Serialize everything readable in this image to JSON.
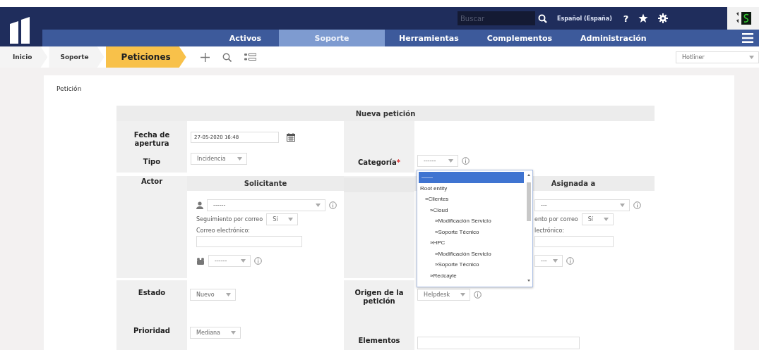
{
  "header": {
    "search": {
      "placeholder": "Buscar"
    },
    "language": "Español (España)",
    "help": "?"
  },
  "nav": [
    {
      "label": "Activos",
      "selected": false
    },
    {
      "label": "Soporte",
      "selected": true
    },
    {
      "label": "Herramientas",
      "selected": false
    },
    {
      "label": "Complementos",
      "selected": false
    },
    {
      "label": "Administración",
      "selected": false
    }
  ],
  "breadcrumb": [
    {
      "label": "Inicio",
      "selected": false
    },
    {
      "label": "Soporte",
      "selected": false
    },
    {
      "label": "Peticiones",
      "selected": true
    }
  ],
  "profile_select": "Hotliner",
  "page_title": "Petición",
  "form": {
    "title": "Nueva petición",
    "fecha": {
      "label": "Fecha de apertura",
      "value": "27-05-2020 16:48"
    },
    "tipo": {
      "label": "Tipo",
      "value": "Incidencia"
    },
    "categoria": {
      "label": "Categoría",
      "required_mark": "*",
      "value": "------"
    },
    "actor": {
      "label": "Actor",
      "requester": {
        "header": "Solicitante",
        "user": "------",
        "follow_label": "Seguimiento por correo",
        "follow_value": "Sí",
        "email_label": "Correo electrónico:",
        "group": "------"
      },
      "assigned": {
        "header": "Asignada a",
        "user": "---",
        "follow_label": "ento por correo",
        "follow_value": "Sí",
        "email_label": "lectrónico:",
        "group": "---"
      }
    },
    "estado": {
      "label": "Estado",
      "value": "Nuevo"
    },
    "origen": {
      "label": "Origen de la petición",
      "value": "Helpdesk"
    },
    "prioridad": {
      "label": "Prioridad",
      "value": "Mediana"
    },
    "elementos": {
      "label": "Elementos"
    }
  },
  "category_dropdown": {
    "items": [
      {
        "label": "——",
        "selected": true
      },
      {
        "label": "Root entity",
        "selected": false,
        "children": [
          {
            "label": "»Clientes",
            "selected": false,
            "children": [
              {
                "label": "»Cloud",
                "selected": false,
                "children": [
                  {
                    "label": "»Modificación Servicio",
                    "selected": false
                  },
                  {
                    "label": "»Soporte Técnico",
                    "selected": false
                  }
                ]
              },
              {
                "label": "»HPC",
                "selected": false,
                "children": [
                  {
                    "label": "»Modificación Servicio",
                    "selected": false
                  },
                  {
                    "label": "»Soporte Técnico",
                    "selected": false
                  }
                ]
              },
              {
                "label": "»Redcayle",
                "selected": false
              }
            ]
          }
        ]
      }
    ]
  }
}
